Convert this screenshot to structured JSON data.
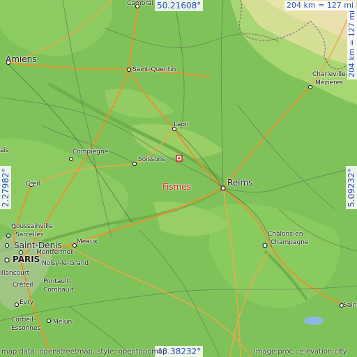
{
  "coords": {
    "top": "50.21608°",
    "bottom": "48.38232°",
    "left": "2.27982°",
    "right": "5.09232°"
  },
  "scale": {
    "horizontal": "204 km = 127 mi",
    "vertical": "204 km = 127 mi"
  },
  "credits": {
    "left": "map data: openstreetmap, style: opentopomap",
    "right": "image proc.: elevation.city"
  },
  "highlight_city": "Fismes",
  "cities": {
    "cambrai": "Cambrai",
    "amiens": "Amiens",
    "saint_quentin": "Saint-Quentin",
    "charleville_1": "Charleville-",
    "charleville_2": "Mézières",
    "laon": "Laon",
    "compiegne": "Compiègne",
    "soissons": "Soissons",
    "reims": "Reims",
    "creil": "Creil",
    "beauvais_frag": "ais",
    "goussainville": "Goussainville",
    "sarcelles": "Sarcelles",
    "saint_denis": "Saint-Denis",
    "meaux": "Meaux",
    "montfermeil": "Montfermeil",
    "paris": "PARIS",
    "noisy": "Noisy-le-Grand",
    "villancourt": "illancourt",
    "creteil": "Créteil",
    "pontault_1": "Pontault-",
    "pontault_2": "Combault",
    "evry": "Évry",
    "corbeil_1": "Corbeil-",
    "corbeil_2": "Essonnes",
    "melun": "Melun",
    "chalons_1": "Châlons-en-",
    "chalons_2": "Champagne",
    "saint_dizier_frag": "Saint"
  },
  "colors": {
    "lowland": "#7fc25a",
    "upland": "#a6d56f",
    "highland": "#e8e3a8",
    "highlight": "#d62020",
    "coord_text": "#2a4fd0"
  }
}
